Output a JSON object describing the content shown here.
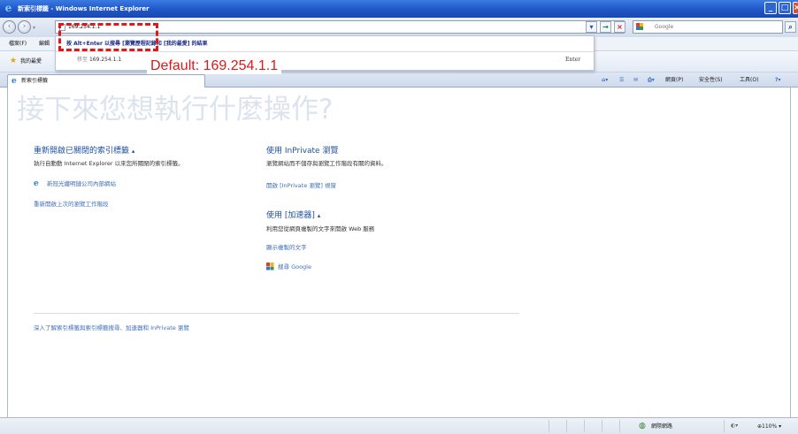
{
  "window": {
    "title": "新索引標籤 - Windows Internet Explorer",
    "buttons": {
      "minimize": "_",
      "maximize": "□",
      "close": "×"
    }
  },
  "address_bar": {
    "value": "169.254.1.1",
    "go_glyph": "→",
    "stop_glyph": "×",
    "dropdown_glyph": "▾"
  },
  "search": {
    "provider": "Google",
    "placeholder": "Google",
    "button_glyph": "⌕"
  },
  "menu": [
    "檔案(F)",
    "編輯"
  ],
  "favorites": {
    "label": "我的最愛"
  },
  "tab": {
    "label": "新索引標籤"
  },
  "command_bar": {
    "page": "網頁(P)",
    "safety": "安全性(S)",
    "tools": "工具(O)"
  },
  "autocomplete": {
    "first_line": "按 Alt+Enter 以搜尋 [瀏覽歷程記錄和 [我的最愛] 的結果",
    "second_prefix": "移至",
    "second_value": "169.254.1.1",
    "enter_hint": "Enter"
  },
  "callout": {
    "text": "Default: 169.254.1.1",
    "color": "#e01818"
  },
  "content": {
    "headline": "接下來您想執行什麼操作?",
    "reopen": {
      "heading": "重新開啟已關閉的索引標籤",
      "desc": "執行自動動 Internet Explorer 以來您所關閉的索引標籤。",
      "link1": "新冠光纖明鏈公司內部網站",
      "link2": "重新開啟上次的瀏覽工作階段"
    },
    "inprivate": {
      "heading": "使用 InPrivate 瀏覽",
      "desc": "瀏覽網站而不儲存與瀏覽工作階段有關的資料。",
      "link": "開啟 [InPrivate 瀏覽] 視窗"
    },
    "accelerator": {
      "heading": "使用 [加速器]",
      "desc": "利用您從網頁複製的文字來開啟 Web 服務",
      "link1": "顯示複製的文字",
      "link2": "搜尋 Google"
    },
    "footer_link": "深入了解索引標籤與索引標籤搜尋、加速器和 InPrivate 瀏覽",
    "caret": "▴"
  },
  "status_bar": {
    "zone": "網際網路",
    "zoom": "110%",
    "zoom_prefix": "▾"
  },
  "colors": {
    "title_bar": "#1f56c9",
    "link": "#3f6fb8",
    "heading": "#1e4f9f",
    "headline": "#dbe3ee"
  }
}
